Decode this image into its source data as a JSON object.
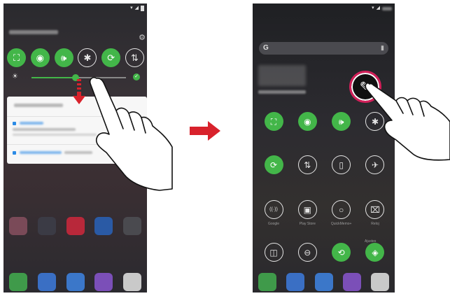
{
  "left_screen": {
    "quick_tiles": [
      {
        "icon": "fullscreen-icon",
        "glyph": "⛶",
        "state": "on"
      },
      {
        "icon": "wifi-icon",
        "glyph": "◉",
        "state": "on"
      },
      {
        "icon": "sound-icon",
        "glyph": "🕪",
        "state": "on"
      },
      {
        "icon": "bluetooth-icon",
        "glyph": "✱",
        "state": "off"
      },
      {
        "icon": "auto-rotate-icon",
        "glyph": "⟳",
        "state": "on"
      },
      {
        "icon": "data-icon",
        "glyph": "⇅",
        "state": "off"
      }
    ],
    "brightness_level": 0.47
  },
  "right_screen": {
    "search_glyph": "G",
    "tile_rows": [
      [
        {
          "icon": "fullscreen-icon",
          "glyph": "⛶",
          "state": "on",
          "label": ""
        },
        {
          "icon": "wifi-icon",
          "glyph": "◉",
          "state": "on",
          "label": ""
        },
        {
          "icon": "sound-icon",
          "glyph": "🕪",
          "state": "on",
          "label": ""
        },
        {
          "icon": "bluetooth-icon",
          "glyph": "✱",
          "state": "off",
          "label": ""
        }
      ],
      [
        {
          "icon": "auto-rotate-icon",
          "glyph": "⟳",
          "state": "on",
          "label": ""
        },
        {
          "icon": "data-icon",
          "glyph": "⇅",
          "state": "off",
          "label": ""
        },
        {
          "icon": "flashlight-icon",
          "glyph": "▯",
          "state": "off",
          "label": ""
        },
        {
          "icon": "airplane-icon",
          "glyph": "✈",
          "state": "off",
          "label": ""
        }
      ],
      [
        {
          "icon": "hotspot-icon",
          "glyph": "((·))",
          "state": "off",
          "label": "Google"
        },
        {
          "icon": "battery-saver-icon",
          "glyph": "▣",
          "state": "off",
          "label": "Play Store"
        },
        {
          "icon": "circle-icon",
          "glyph": "○",
          "state": "off",
          "label": "QuickMemo+"
        },
        {
          "icon": "nfc-icon",
          "glyph": "⌧",
          "state": "off",
          "label": "Reloj"
        }
      ],
      [
        {
          "icon": "dual-window-icon",
          "glyph": "◫",
          "state": "off",
          "label": ""
        },
        {
          "icon": "do-not-disturb-icon",
          "glyph": "⊖",
          "state": "off",
          "label": ""
        },
        {
          "icon": "sync-icon",
          "glyph": "⟲",
          "state": "on",
          "label": ""
        },
        {
          "icon": "location-icon",
          "glyph": "◈",
          "state": "on",
          "label": ""
        }
      ]
    ],
    "extra_label": "Ajustes",
    "colors": {
      "accent": "#43b649",
      "highlight_ring": "#d3205a"
    }
  }
}
